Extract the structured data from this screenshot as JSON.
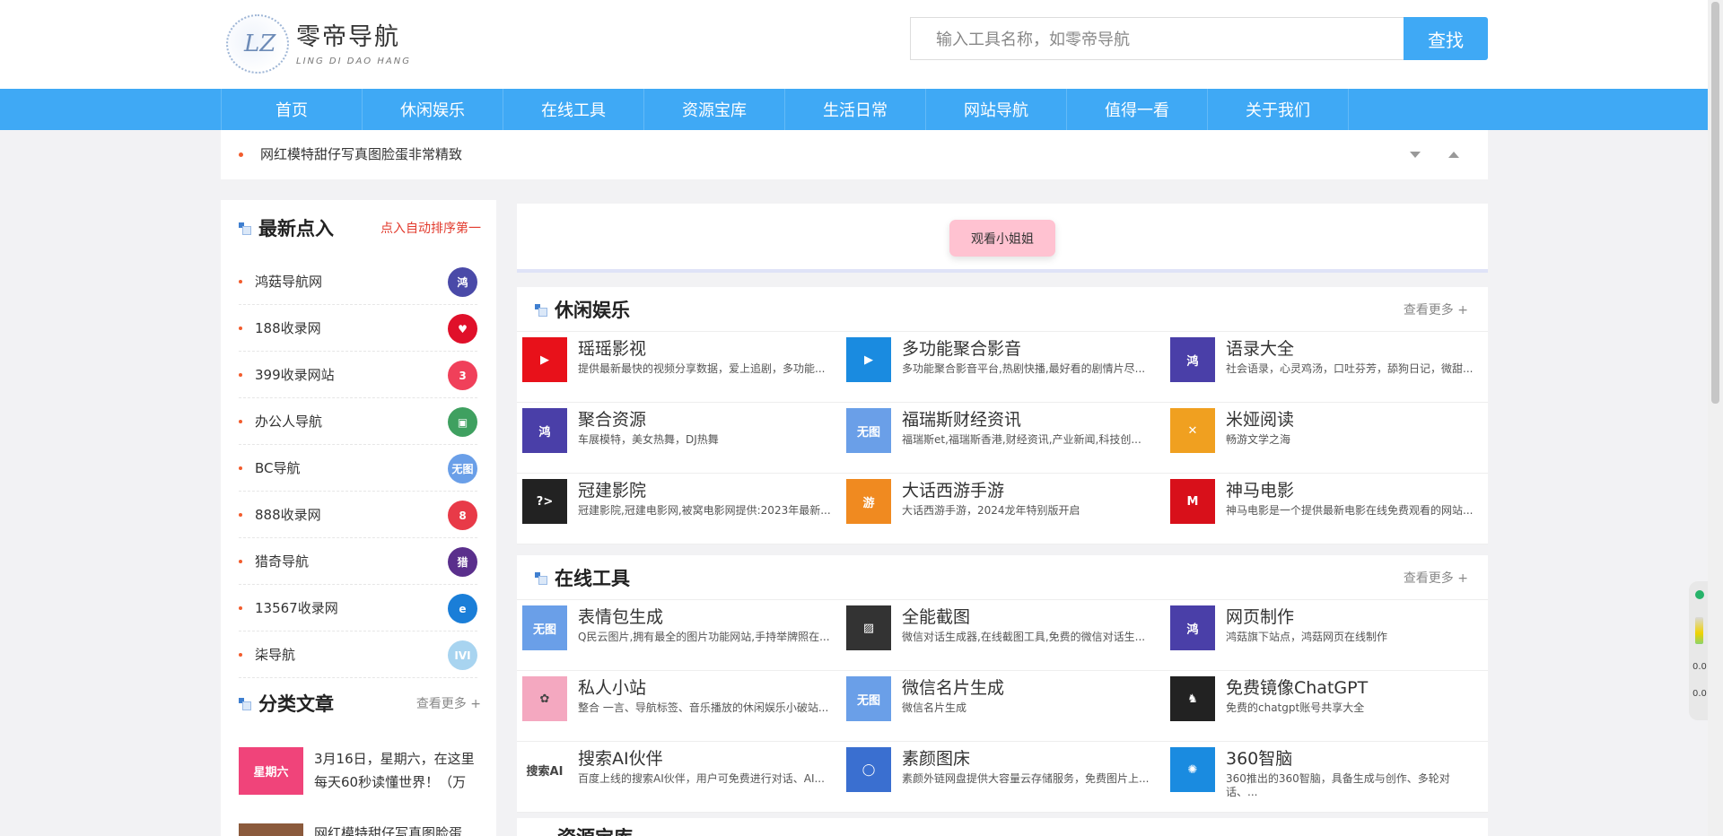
{
  "header": {
    "logo_mark": "LZ",
    "logo_title": "零帝导航",
    "logo_sub": "LING DI DAO HANG",
    "search_placeholder": "输入工具名称，如零帝导航",
    "search_button": "查找"
  },
  "nav": [
    "首页",
    "休闲娱乐",
    "在线工具",
    "资源宝库",
    "生活日常",
    "网站导航",
    "值得一看",
    "关于我们"
  ],
  "ticker": {
    "text": "网红模特甜仔写真图脸蛋非常精致"
  },
  "sidebar": {
    "latest_title": "最新点入",
    "latest_extra": "点入自动排序第一",
    "latest": [
      {
        "name": "鸿菇导航网",
        "avatar": "鸿",
        "color": "#4a4aa8"
      },
      {
        "name": "188收录网",
        "avatar": "♥",
        "color": "#e0102a"
      },
      {
        "name": "399收录网站",
        "avatar": "3",
        "color": "#f0405a"
      },
      {
        "name": "办公人导航",
        "avatar": "▣",
        "color": "#3fa060"
      },
      {
        "name": "BC导航",
        "avatar": "无图",
        "color": "#6a9fe8"
      },
      {
        "name": "888收录网",
        "avatar": "8",
        "color": "#e83a48"
      },
      {
        "name": "猎奇导航",
        "avatar": "猎",
        "color": "#5a2f8c"
      },
      {
        "name": "13567收录网",
        "avatar": "e",
        "color": "#1a7ed8"
      },
      {
        "name": "柒导航",
        "avatar": "IVI",
        "color": "#a8d4f0"
      }
    ],
    "article_title": "分类文章",
    "article_more": "查看更多 +",
    "article1_thumb": "星期六",
    "article1_text": "3月16日，星期六，在这里每天60秒读懂世界！（万",
    "article2_text": "网红模特甜仔写真图脸蛋..."
  },
  "banner": {
    "button": "观看小姐姐"
  },
  "sections": [
    {
      "title": "休闲娱乐",
      "more": "查看更多 +",
      "sites": [
        {
          "name": "瑶瑶影视",
          "desc": "提供最新最快的视频分享数据，爱上追剧，多功能...",
          "icon": "▶",
          "color": "#e8111a"
        },
        {
          "name": "多功能聚合影音",
          "desc": "多功能聚合影音平台,热剧快播,最好看的剧情片尽...",
          "icon": "▶",
          "color": "#1a8be0"
        },
        {
          "name": "语录大全",
          "desc": "社会语录，心灵鸡汤，口吐芬芳，舔狗日记，微甜...",
          "icon": "鸿",
          "color": "#4a3fa8"
        },
        {
          "name": "聚合资源",
          "desc": "车展模特，美女热舞，DJ热舞",
          "icon": "鸿",
          "color": "#4a3fa8"
        },
        {
          "name": "福瑞斯财经资讯",
          "desc": "福瑞斯et,福瑞斯香港,财经资讯,产业新闻,科技创...",
          "icon": "无图",
          "color": "#6a9fe8"
        },
        {
          "name": "米娅阅读",
          "desc": "畅游文学之海",
          "icon": "✕",
          "color": "#f0a020"
        },
        {
          "name": "冠建影院",
          "desc": "冠建影院,冠建电影网,被窝电影网提供:2023年最新...",
          "icon": "?>",
          "color": "#222222"
        },
        {
          "name": "大话西游手游",
          "desc": "大话西游手游，2024龙年特别版开启",
          "icon": "游",
          "color": "#f08a20"
        },
        {
          "name": "神马电影",
          "desc": "神马电影是一个提供最新电影在线免费观看的网站...",
          "icon": "M",
          "color": "#d8101a"
        }
      ]
    },
    {
      "title": "在线工具",
      "more": "查看更多 +",
      "sites": [
        {
          "name": "表情包生成",
          "desc": "Q民云图片,拥有最全的图片功能网站,手持举牌照在...",
          "icon": "无图",
          "color": "#6a9fe8"
        },
        {
          "name": "全能截图",
          "desc": "微信对话生成器,在线截图工具,免费的微信对话生...",
          "icon": "▨",
          "color": "#333333"
        },
        {
          "name": "网页制作",
          "desc": "鸿菇旗下站点，鸿菇网页在线制作",
          "icon": "鸿",
          "color": "#4a3fa8"
        },
        {
          "name": "私人小站",
          "desc": "整合 一言、导航标签、音乐播放的休闲娱乐小破站...",
          "icon": "✿",
          "color": "#f4a8c0"
        },
        {
          "name": "微信名片生成",
          "desc": "微信名片生成",
          "icon": "无图",
          "color": "#6a9fe8"
        },
        {
          "name": "免费镜像ChatGPT",
          "desc": "免费的chatgpt账号共享大全",
          "icon": "♞",
          "color": "#222222"
        },
        {
          "name": "搜索AI伙伴",
          "desc": "百度上线的搜索AI伙伴，用户可免费进行对话、AI...",
          "icon": "搜索AI",
          "color": "#ffffff"
        },
        {
          "name": "素颜图床",
          "desc": "素颜外链网盘提供大容量云存储服务，免费图片上...",
          "icon": "◯",
          "color": "#3a6fd0"
        },
        {
          "name": "360智脑",
          "desc": "360推出的360智脑，具备生成与创作、多轮对话、...",
          "icon": "✺",
          "color": "#1a8be0"
        }
      ]
    }
  ],
  "partial_title": "资源宝库",
  "widget": {
    "t1": "0.0",
    "t2": "0.0"
  },
  "colors": {
    "accent": "#3fa9f5",
    "red": "#e23b2e",
    "pink": "#ffc2d1"
  }
}
